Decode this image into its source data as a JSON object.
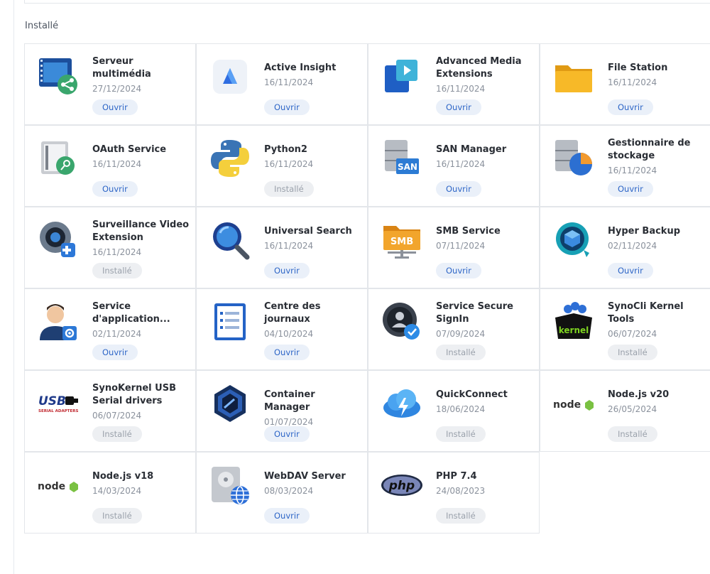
{
  "section": {
    "title": "Installé"
  },
  "apps": [
    {
      "name": "Serveur multimédia",
      "date": "27/12/2024",
      "button": "Ouvrir",
      "state": "open",
      "icon": "media-server-icon"
    },
    {
      "name": "Active Insight",
      "date": "16/11/2024",
      "button": "Ouvrir",
      "state": "open",
      "icon": "active-insight-icon"
    },
    {
      "name": "Advanced Media Extensions",
      "date": "16/11/2024",
      "button": "Ouvrir",
      "state": "open",
      "icon": "media-extensions-icon"
    },
    {
      "name": "File Station",
      "date": "16/11/2024",
      "button": "Ouvrir",
      "state": "open",
      "icon": "folder-icon"
    },
    {
      "name": "OAuth Service",
      "date": "16/11/2024",
      "button": "Ouvrir",
      "state": "open",
      "icon": "vault-key-icon"
    },
    {
      "name": "Python2",
      "date": "16/11/2024",
      "button": "Installé",
      "state": "installed",
      "icon": "python-icon"
    },
    {
      "name": "SAN Manager",
      "date": "16/11/2024",
      "button": "Ouvrir",
      "state": "open",
      "icon": "san-database-icon"
    },
    {
      "name": "Gestionnaire de stockage",
      "date": "16/11/2024",
      "button": "Ouvrir",
      "state": "open",
      "icon": "storage-pie-icon"
    },
    {
      "name": "Surveillance Video Extension",
      "date": "16/11/2024",
      "button": "Installé",
      "state": "installed",
      "icon": "camera-plugin-icon"
    },
    {
      "name": "Universal Search",
      "date": "16/11/2024",
      "button": "Ouvrir",
      "state": "open",
      "icon": "magnifier-icon"
    },
    {
      "name": "SMB Service",
      "date": "07/11/2024",
      "button": "Ouvrir",
      "state": "open",
      "icon": "smb-folder-icon"
    },
    {
      "name": "Hyper Backup",
      "date": "02/11/2024",
      "button": "Ouvrir",
      "state": "open",
      "icon": "backup-cube-icon"
    },
    {
      "name": "Service d'application...",
      "date": "02/11/2024",
      "button": "Ouvrir",
      "state": "open",
      "icon": "user-gear-icon"
    },
    {
      "name": "Centre des journaux",
      "date": "04/10/2024",
      "button": "Ouvrir",
      "state": "open",
      "icon": "log-list-icon"
    },
    {
      "name": "Service Secure SignIn",
      "date": "07/09/2024",
      "button": "Installé",
      "state": "installed",
      "icon": "secure-signin-icon"
    },
    {
      "name": "SynoCli Kernel Tools",
      "date": "06/07/2024",
      "button": "Installé",
      "state": "installed",
      "icon": "kernel-box-icon"
    },
    {
      "name": "SynoKernel USB Serial drivers",
      "date": "06/07/2024",
      "button": "Installé",
      "state": "installed",
      "icon": "usb-serial-icon"
    },
    {
      "name": "Container Manager",
      "date": "01/07/2024",
      "button": "Ouvrir",
      "state": "open",
      "icon": "container-hexagon-icon"
    },
    {
      "name": "QuickConnect",
      "date": "18/06/2024",
      "button": "Installé",
      "state": "installed",
      "icon": "cloud-bolt-icon"
    },
    {
      "name": "Node.js v20",
      "date": "26/05/2024",
      "button": "Installé",
      "state": "installed",
      "icon": "nodejs-icon"
    },
    {
      "name": "Node.js v18",
      "date": "14/03/2024",
      "button": "Installé",
      "state": "installed",
      "icon": "nodejs-icon"
    },
    {
      "name": "WebDAV Server",
      "date": "08/03/2024",
      "button": "Ouvrir",
      "state": "open",
      "icon": "webdav-globe-icon"
    },
    {
      "name": "PHP 7.4",
      "date": "24/08/2023",
      "button": "Installé",
      "state": "installed",
      "icon": "php-icon"
    }
  ],
  "icon_text": {
    "san": "SAN",
    "smb": "SMB",
    "kernel": "kernel",
    "usb": "USB",
    "usb_sub": "SERIAL ADAPTERS",
    "node": "node",
    "php": "php"
  }
}
